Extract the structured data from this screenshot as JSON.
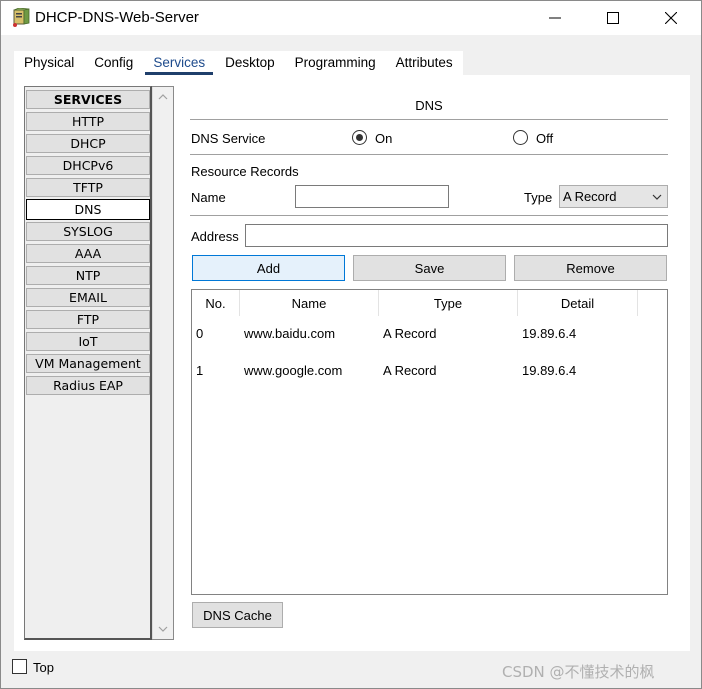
{
  "window": {
    "title": "DHCP-DNS-Web-Server",
    "controls": [
      "minimize",
      "maximize",
      "close"
    ]
  },
  "tabs": [
    {
      "label": "Physical"
    },
    {
      "label": "Config"
    },
    {
      "label": "Services",
      "active": true
    },
    {
      "label": "Desktop"
    },
    {
      "label": "Programming"
    },
    {
      "label": "Attributes"
    }
  ],
  "sidebar": {
    "items": [
      {
        "label": "SERVICES"
      },
      {
        "label": "HTTP"
      },
      {
        "label": "DHCP"
      },
      {
        "label": "DHCPv6"
      },
      {
        "label": "TFTP"
      },
      {
        "label": "DNS",
        "selected": true
      },
      {
        "label": "SYSLOG"
      },
      {
        "label": "AAA"
      },
      {
        "label": "NTP"
      },
      {
        "label": "EMAIL"
      },
      {
        "label": "FTP"
      },
      {
        "label": "IoT"
      },
      {
        "label": "VM Management"
      },
      {
        "label": "Radius EAP"
      }
    ]
  },
  "dns": {
    "title": "DNS",
    "service_label": "DNS Service",
    "on_label": "On",
    "off_label": "Off",
    "service_state": "On",
    "records_label": "Resource Records",
    "name_label": "Name",
    "name_value": "",
    "type_label": "Type",
    "type_value": "A Record",
    "address_label": "Address",
    "address_value": "",
    "add_label": "Add",
    "save_label": "Save",
    "remove_label": "Remove",
    "cache_label": "DNS Cache"
  },
  "table": {
    "columns": [
      "No.",
      "Name",
      "Type",
      "Detail"
    ],
    "rows": [
      {
        "no": "0",
        "name": "www.baidu.com",
        "type": "A Record",
        "detail": "19.89.6.4"
      },
      {
        "no": "1",
        "name": "www.google.com",
        "type": "A Record",
        "detail": "19.89.6.4"
      }
    ]
  },
  "footer": {
    "top_label": "Top",
    "top_checked": false,
    "watermark": "CSDN @不懂技术的枫"
  },
  "colors": {
    "active_tab_underline": "#1f3f6b",
    "focused_button": "#e5f1fb",
    "focus_border": "#0078d7"
  }
}
